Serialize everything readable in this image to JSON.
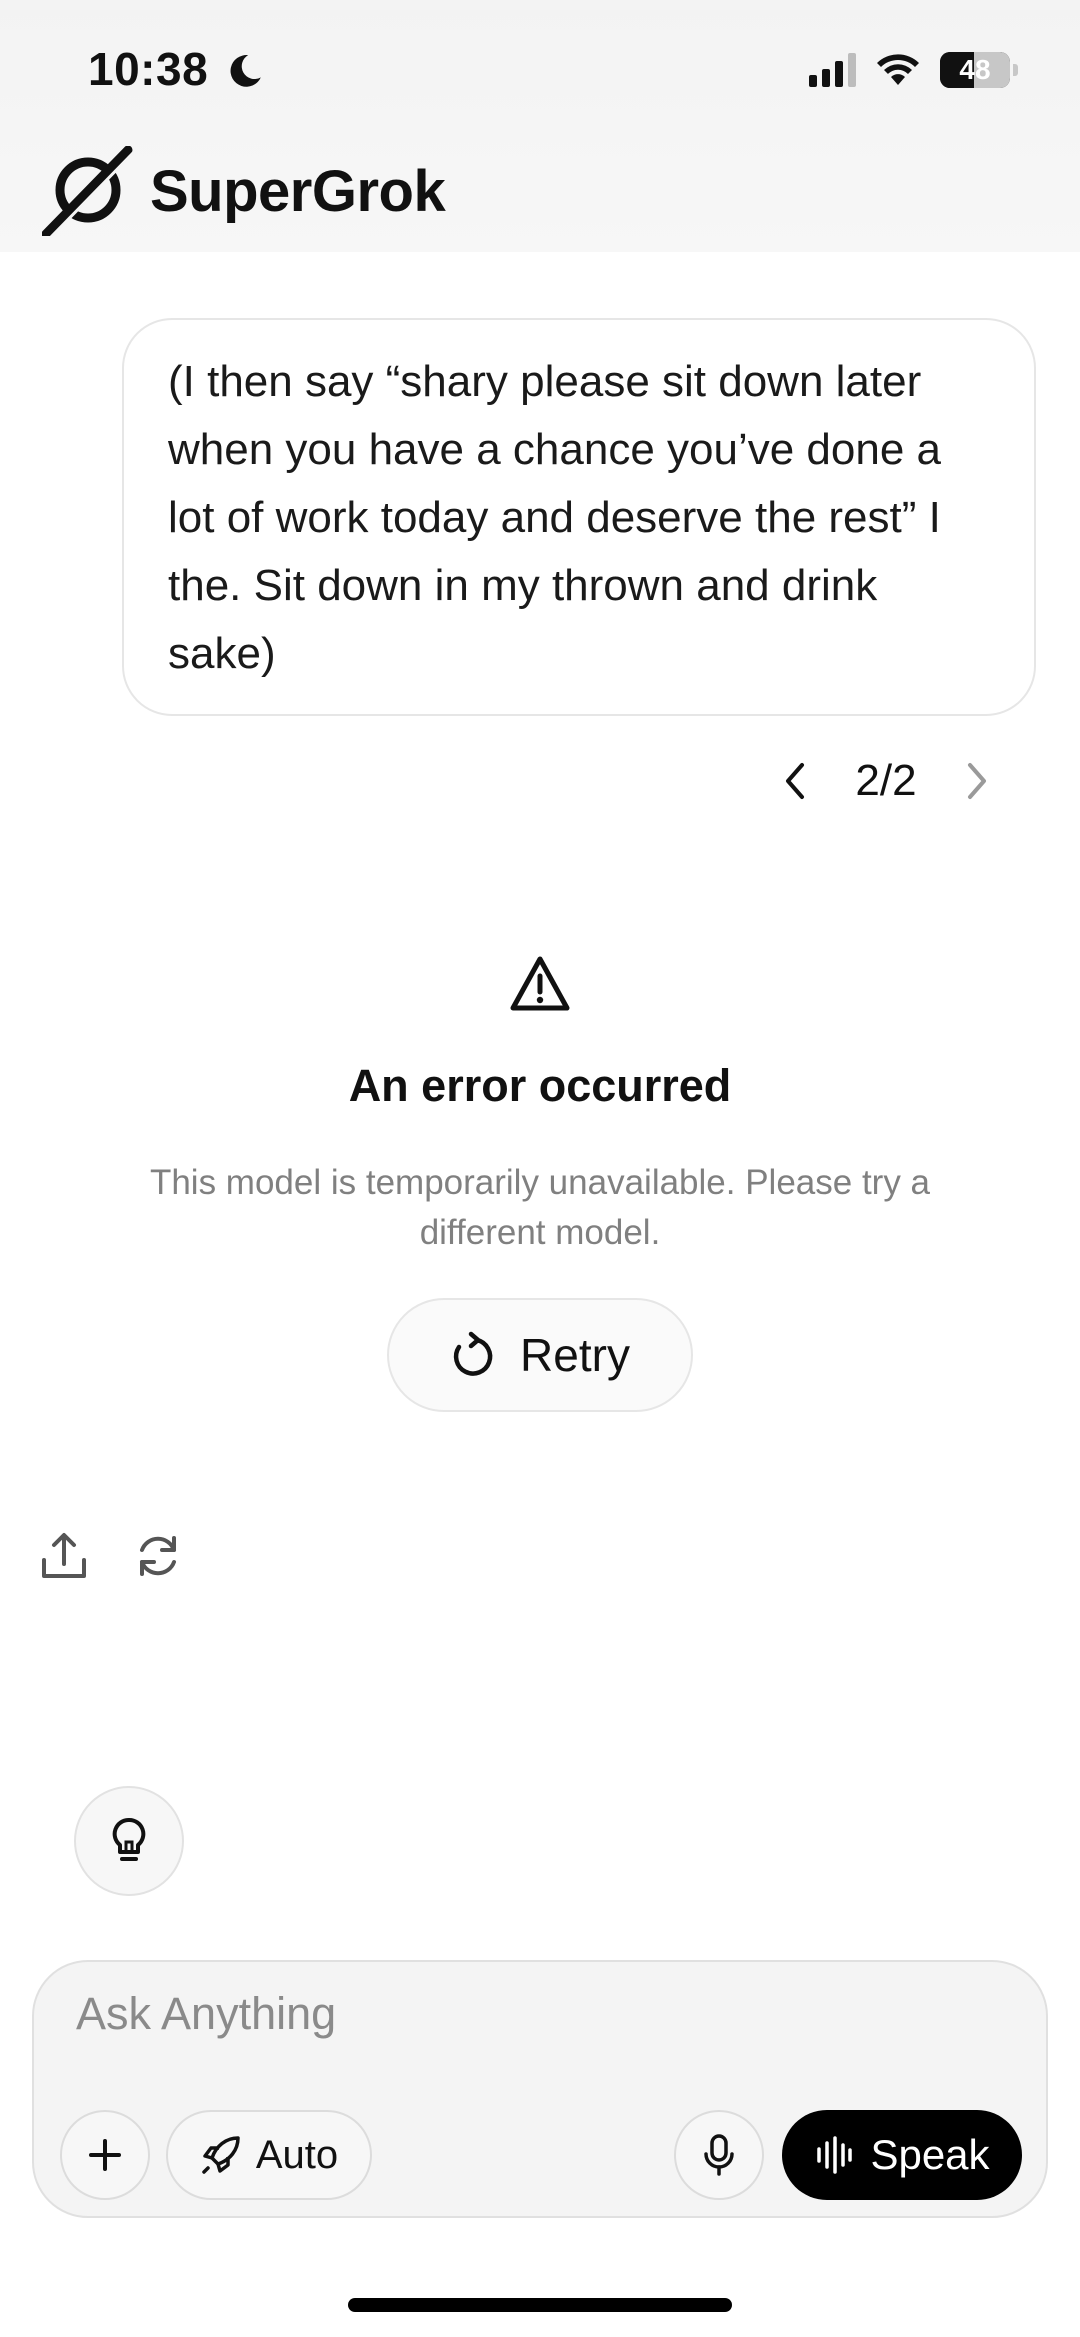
{
  "status_bar": {
    "time": "10:38",
    "battery": "48"
  },
  "header": {
    "app_name": "SuperGrok"
  },
  "message": {
    "text": "(I then say “shary please sit down later when you have a chance you’ve done a lot of work today and deserve the rest” I the. Sit down in my thrown and drink sake)",
    "pager": "2/2"
  },
  "error": {
    "title": "An error occurred",
    "message": "This model is temporarily unavailable. Please try a different model.",
    "retry_label": "Retry"
  },
  "composer": {
    "placeholder": "Ask Anything",
    "mode_label": "Auto",
    "speak_label": "Speak"
  }
}
